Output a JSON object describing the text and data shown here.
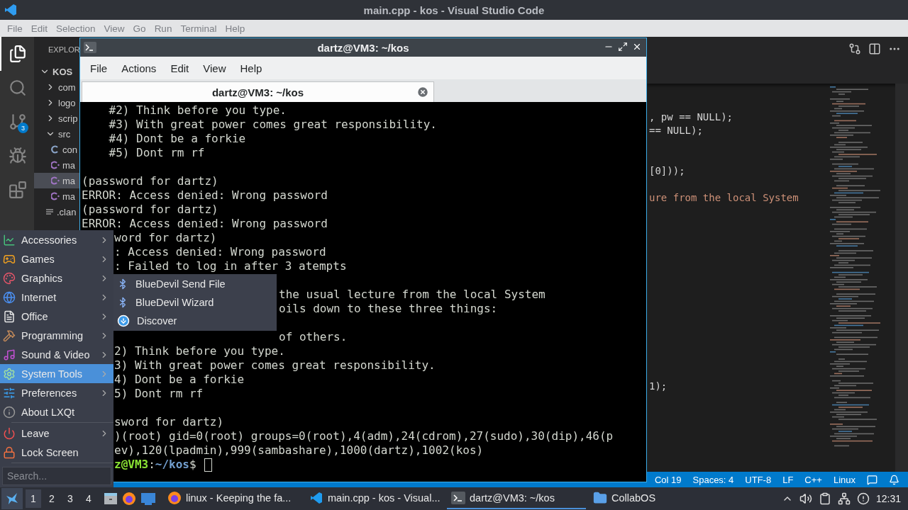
{
  "vscode": {
    "title": "main.cpp - kos - Visual Studio Code",
    "menu": [
      "File",
      "Edit",
      "Selection",
      "View",
      "Go",
      "Run",
      "Terminal",
      "Help"
    ],
    "activity_bar": [
      {
        "selected": true
      },
      {
        "selected": false
      },
      {
        "selected": false,
        "badge": "3"
      },
      {
        "selected": false
      },
      {
        "selected": false
      }
    ],
    "explorer": {
      "header": "EXPLOR",
      "root": {
        "label": "KOS",
        "expanded": true
      },
      "items": [
        {
          "label": "com",
          "kind": "folder",
          "expanded": false,
          "selected": false
        },
        {
          "label": "logo",
          "kind": "folder",
          "expanded": false,
          "selected": false
        },
        {
          "label": "scrip",
          "kind": "folder",
          "expanded": false,
          "selected": false
        },
        {
          "label": "src",
          "kind": "folder",
          "expanded": true,
          "selected": false,
          "children": [
            {
              "label": "con",
              "kind": "c",
              "selected": false
            },
            {
              "label": "ma",
              "kind": "cpp",
              "selected": false
            },
            {
              "label": "ma",
              "kind": "cpp",
              "selected": true
            },
            {
              "label": "ma",
              "kind": "cpp",
              "selected": false
            }
          ]
        },
        {
          "label": ".clan",
          "kind": "config",
          "selected": false
        }
      ]
    },
    "editor": {
      "lines": [
        {
          "kind": "code",
          "text": ", pw == NULL);"
        },
        {
          "kind": "code",
          "text": "== NULL);"
        },
        {
          "kind": "blank"
        },
        {
          "kind": "blank"
        },
        {
          "kind": "code",
          "text": "[0]));"
        },
        {
          "kind": "blank"
        },
        {
          "kind": "comment",
          "text": "ure from the local System"
        },
        {
          "kind": "blank"
        },
        {
          "kind": "blank"
        },
        {
          "kind": "blank"
        },
        {
          "kind": "blank"
        },
        {
          "kind": "blank"
        },
        {
          "kind": "blank"
        },
        {
          "kind": "blank"
        },
        {
          "kind": "blank"
        },
        {
          "kind": "blank"
        },
        {
          "kind": "blank"
        },
        {
          "kind": "blank"
        },
        {
          "kind": "blank"
        },
        {
          "kind": "blank"
        },
        {
          "kind": "code",
          "text": "1);"
        }
      ]
    },
    "status_bar": [
      "Col 19",
      "Spaces: 4",
      "UTF-8",
      "LF",
      "C++",
      "Linux"
    ]
  },
  "terminal": {
    "title": "dartz@VM3: ~/kos",
    "menu": [
      "File",
      "Actions",
      "Edit",
      "View",
      "Help"
    ],
    "tab": {
      "title": "dartz@VM3: ~/kos",
      "selected": true
    },
    "lines": [
      {
        "kind": "full",
        "text": "    #2) Think before you type."
      },
      {
        "kind": "full",
        "text": "    #3) With great power comes great responsibility."
      },
      {
        "kind": "full",
        "text": "    #4) Dont be a forkie"
      },
      {
        "kind": "full",
        "text": "    #5) Dont rm rf"
      },
      {
        "kind": "blank"
      },
      {
        "kind": "full",
        "text": "(password for dartz)"
      },
      {
        "kind": "full",
        "text": "ERROR: Access denied: Wrong password"
      },
      {
        "kind": "full",
        "text": "(password for dartz)"
      },
      {
        "kind": "full",
        "text": "ERROR: Access denied: Wrong password"
      },
      {
        "kind": "under_menu",
        "text": "word for dartz)"
      },
      {
        "kind": "under_menu",
        "text": ": Access denied: Wrong password"
      },
      {
        "kind": "under_menu",
        "text": ": Failed to log in after 3 atempts"
      },
      {
        "kind": "blank"
      },
      {
        "kind": "under_submenu",
        "text": "the usual lecture from the local System"
      },
      {
        "kind": "under_submenu",
        "text": "oils down to these three things:"
      },
      {
        "kind": "blank"
      },
      {
        "kind": "under_submenu",
        "text": "of others."
      },
      {
        "kind": "under_menu",
        "text": "2) Think before you type."
      },
      {
        "kind": "under_menu",
        "text": "3) With great power comes great responsibility."
      },
      {
        "kind": "under_menu",
        "text": "4) Dont be a forkie"
      },
      {
        "kind": "under_menu",
        "text": "5) Dont rm rf"
      },
      {
        "kind": "blank"
      },
      {
        "kind": "under_menu",
        "text": "sword for dartz)"
      },
      {
        "kind": "under_menu",
        "text": ")(root) gid=0(root) groups=0(root),4(adm),24(cdrom),27(sudo),30(dip),46(p"
      },
      {
        "kind": "under_menu",
        "text": "ev),120(lpadmin),999(sambashare),1000(dartz),1002(kos)"
      }
    ],
    "prompt": {
      "host": "z@VM3",
      "separator": ":",
      "path": "~/kos",
      "symbol": "$"
    }
  },
  "launcher": {
    "groups": [
      [
        {
          "label": "Accessories",
          "submenu": true,
          "selected": false
        },
        {
          "label": "Games",
          "submenu": true,
          "selected": false
        },
        {
          "label": "Graphics",
          "submenu": true,
          "selected": false
        },
        {
          "label": "Internet",
          "submenu": true,
          "selected": false
        },
        {
          "label": "Office",
          "submenu": true,
          "selected": false
        },
        {
          "label": "Programming",
          "submenu": true,
          "selected": false
        },
        {
          "label": "Sound & Video",
          "submenu": true,
          "selected": false
        },
        {
          "label": "System Tools",
          "submenu": true,
          "selected": true
        },
        {
          "label": "Preferences",
          "submenu": true,
          "selected": false
        },
        {
          "label": "About LXQt",
          "submenu": false,
          "selected": false
        }
      ],
      [
        {
          "label": "Leave",
          "submenu": true,
          "selected": false
        },
        {
          "label": "Lock Screen",
          "submenu": false,
          "selected": false
        }
      ]
    ],
    "search": {
      "placeholder": "Search..."
    },
    "submenu": {
      "items": [
        {
          "label": "BlueDevil Send File",
          "kind": "bluetooth"
        },
        {
          "label": "BlueDevil Wizard",
          "kind": "bluetooth"
        },
        {
          "label": "Discover",
          "kind": "download"
        }
      ]
    }
  },
  "taskbar": {
    "desktops": [
      {
        "label": "1",
        "selected": true
      },
      {
        "label": "2",
        "selected": false
      },
      {
        "label": "3",
        "selected": false
      },
      {
        "label": "4",
        "selected": false
      }
    ],
    "tasks": [
      {
        "label": "linux - Keeping the fa...",
        "kind": "browser",
        "selected": false
      },
      {
        "label": "main.cpp - kos - Visual...",
        "kind": "editor",
        "selected": false
      },
      {
        "label": "dartz@VM3: ~/kos",
        "kind": "terminal",
        "selected": true
      },
      {
        "label": "CollabOS",
        "kind": "folder",
        "selected": false
      }
    ],
    "clock": "12:31"
  }
}
